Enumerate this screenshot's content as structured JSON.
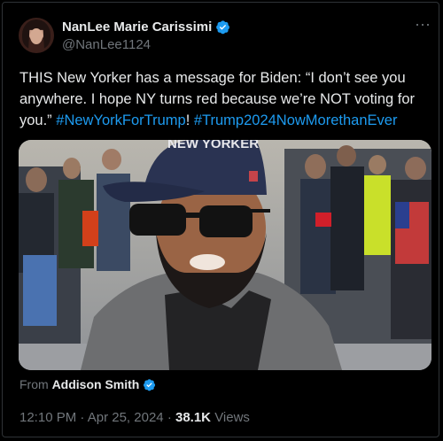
{
  "author": {
    "display_name": "NanLee Marie Carissimi",
    "handle": "@NanLee1124",
    "verified_badge_color": "#1d9bf0"
  },
  "menu": {
    "more_label": "···"
  },
  "tweet": {
    "text_plain": "THIS New Yorker has a message for Biden: “I don’t see you anywhere. I hope NY turns red because we’re NOT voting for you.” ",
    "hashtag_1": "#NewYorkForTrump",
    "separator": "! ",
    "hashtag_2": "#Trump2024NowMorethanEver",
    "hashtag_color": "#1d9bf0"
  },
  "media": {
    "hat_text_line1": "NEW YORKER",
    "icon": "video-still-image"
  },
  "attribution": {
    "from_label": "From",
    "source_name": "Addison Smith"
  },
  "meta": {
    "time": "12:10 PM",
    "dot": "·",
    "date": "Apr 25, 2024",
    "views_count": "38.1K",
    "views_label": "Views"
  }
}
